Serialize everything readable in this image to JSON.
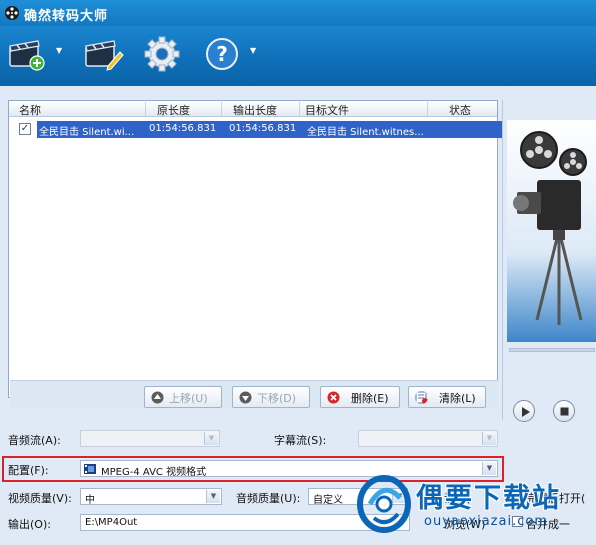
{
  "window": {
    "title": "确然转码大师"
  },
  "toolbar": {
    "buttons": [
      {
        "name": "add-file",
        "icon": "clapperboard-add-icon"
      },
      {
        "name": "edit",
        "icon": "clapperboard-edit-icon"
      },
      {
        "name": "settings",
        "icon": "gear-icon"
      },
      {
        "name": "help",
        "icon": "help-icon",
        "label": "?"
      }
    ]
  },
  "file_list": {
    "columns": [
      "名称",
      "原长度",
      "输出长度",
      "目标文件",
      "状态"
    ],
    "rows": [
      {
        "checked": true,
        "name": "全民目击 Silent.wi...",
        "source_length": "01:54:56.831",
        "output_length": "01:54:56.831",
        "target": "全民目击 Silent.witnes...",
        "status": ""
      }
    ],
    "check_mark": "✓"
  },
  "actions": {
    "move_up": "上移(U)",
    "move_down": "下移(D)",
    "delete": "删除(E)",
    "clear": "清除(L)"
  },
  "settings": {
    "audio_stream_label": "音频流(A):",
    "audio_stream_value": "",
    "subtitle_label": "字幕流(S):",
    "subtitle_value": "",
    "config_label": "配置(F):",
    "config_value": "MPEG-4 AVC 视频格式",
    "video_quality_label": "视频质量(V):",
    "video_quality_value": "中",
    "audio_quality_label": "音频质量(U):",
    "audio_quality_value": "自定义",
    "output_label": "输出(O):",
    "output_value": "E:\\MP4Out",
    "settings_btn": "设置(",
    "browse_btn": "浏览(W)",
    "open_after_label": "完成后打开(",
    "merge_label": "合并成一"
  },
  "watermark": {
    "title": "偶要下载站",
    "url": "ouyaoxiazai.com"
  },
  "colors": {
    "titlebar": "#1478c2",
    "selection": "#2f63c9",
    "highlight_border": "#d9232a",
    "panel": "#dfeaf6"
  }
}
